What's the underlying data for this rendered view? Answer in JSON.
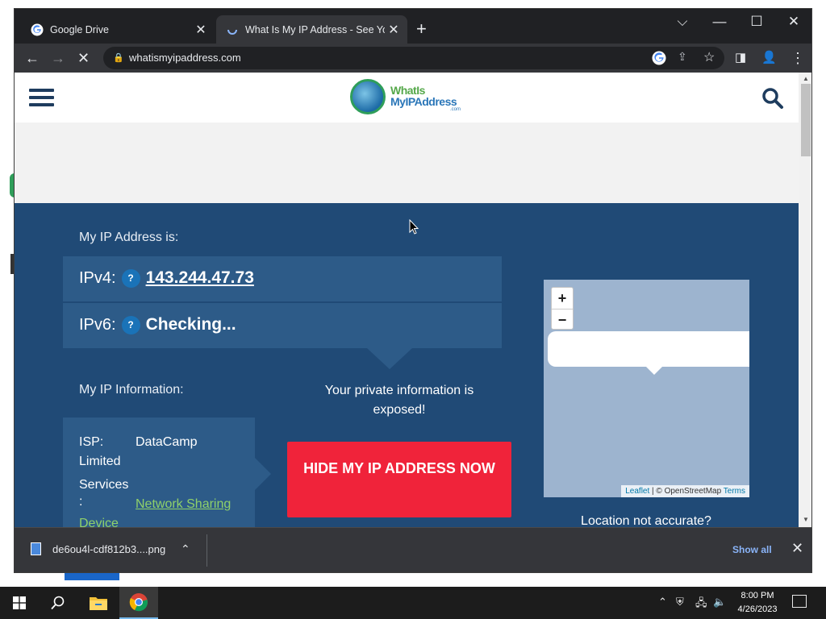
{
  "browser": {
    "tabs": [
      {
        "title": "Google Drive",
        "icon": "google-icon",
        "active": false
      },
      {
        "title": "What Is My IP Address - See Your",
        "icon": "loading-spinner-icon",
        "active": true
      }
    ],
    "url": "whatismyipaddress.com"
  },
  "site": {
    "logo": {
      "line1": "WhatIs",
      "line2": "MyIPAddress",
      "suffix": ".com"
    },
    "hero": {
      "my_ip_label": "My IP Address is:",
      "ipv4_label": "IPv4:",
      "ipv4_value": "143.244.47.73",
      "ipv6_label": "IPv6:",
      "ipv6_value": "Checking...",
      "help_glyph": "?",
      "my_info_label": "My IP Information:",
      "isp_label": "ISP:",
      "isp_value_1": "DataCamp",
      "isp_value_2": "Limited",
      "services_label": "Services",
      "services_colon": ":",
      "services_value_1": "Network Sharing",
      "services_value_2": "Device",
      "exposed_text": "Your private information is exposed!",
      "hide_button": "HIDE MY IP ADDRESS NOW",
      "location_text": "Location not accurate?"
    },
    "map": {
      "zoom_in": "+",
      "zoom_out": "−",
      "attribution_leaflet": "Leaflet",
      "attribution_mid": " | © OpenStreetMap ",
      "attribution_terms": "Terms"
    }
  },
  "download": {
    "filename": "de6ou4l-cdf812b3....png",
    "show_all": "Show all"
  },
  "taskbar": {
    "time": "8:00 PM",
    "date": "4/26/2023"
  },
  "colors": {
    "hero_bg": "#204a76",
    "panel_bg": "#2d5b88",
    "cta_red": "#f0233a",
    "link_green": "#8fd16a"
  }
}
